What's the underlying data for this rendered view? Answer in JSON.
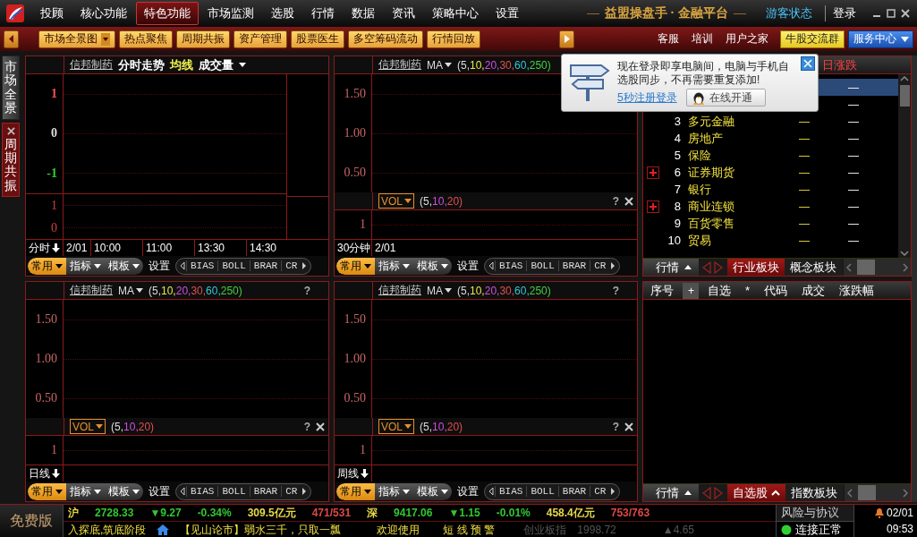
{
  "menu": {
    "items": [
      {
        "label": "投顾",
        "selected": false
      },
      {
        "label": "核心功能",
        "selected": false
      },
      {
        "label": "特色功能",
        "selected": true
      },
      {
        "label": "市场监测",
        "selected": false
      },
      {
        "label": "选股",
        "selected": false
      },
      {
        "label": "行情",
        "selected": false
      },
      {
        "label": "数据",
        "selected": false
      },
      {
        "label": "资讯",
        "selected": false
      },
      {
        "label": "策略中心",
        "selected": false
      },
      {
        "label": "设置",
        "selected": false
      }
    ],
    "title": "益盟操盘手 · 金融平台",
    "guest": "游客状态",
    "login": "登录"
  },
  "toolbar": {
    "buttons": [
      {
        "label": "市场全景图",
        "dropdown": true
      },
      {
        "label": "热点聚焦",
        "dropdown": false
      },
      {
        "label": "周期共振",
        "dropdown": false
      },
      {
        "label": "资产管理",
        "dropdown": false
      },
      {
        "label": "股票医生",
        "dropdown": false
      },
      {
        "label": "多空筹码流动",
        "dropdown": false
      },
      {
        "label": "行情回放",
        "dropdown": false
      }
    ],
    "links": [
      "客服",
      "培训",
      "用户之家"
    ],
    "group_button": "牛股交流群",
    "service_button": "服务中心"
  },
  "side_tabs": [
    {
      "label": "市场全景",
      "selected": false,
      "closable": false
    },
    {
      "label": "周期共振",
      "selected": true,
      "closable": true
    }
  ],
  "charts": [
    {
      "kind": "intraday",
      "stock": "信邦制药",
      "header_items": [
        {
          "text": "分时走势",
          "color": "#ffffff"
        },
        {
          "text": "均线",
          "color": "#f0f050"
        },
        {
          "text": "成交量",
          "color": "#ffffff"
        }
      ],
      "y_labels": [
        {
          "text": "1",
          "color": "#ff5050"
        },
        {
          "text": "0",
          "color": "#dddddd"
        },
        {
          "text": "-1",
          "color": "#30d030"
        }
      ],
      "sub_y_labels": [
        "1",
        "0"
      ],
      "period": "分时",
      "time_labels": [
        "2/01",
        "10:00",
        "11:00",
        "13:30",
        "14:30"
      ],
      "tools": {
        "tabs": [
          {
            "label": "常用",
            "selected": true
          },
          {
            "label": "指标",
            "selected": false
          },
          {
            "label": "模板",
            "selected": false
          }
        ],
        "settings": "设置",
        "indicators": [
          "BIAS",
          "BOLL",
          "BRAR",
          "CR"
        ]
      }
    },
    {
      "kind": "kline",
      "stock": "信邦制药",
      "indicator": "MA",
      "params": [
        {
          "text": "(5,",
          "color": "#dddddd"
        },
        {
          "text": "10,",
          "color": "#e8e84a"
        },
        {
          "text": "20,",
          "color": "#d050e0"
        },
        {
          "text": "30,",
          "color": "#e05050"
        },
        {
          "text": "60,",
          "color": "#30c8d8"
        },
        {
          "text": "250)",
          "color": "#40d040"
        }
      ],
      "y_labels": [
        "1.50",
        "1.00",
        "0.50"
      ],
      "vol_indicator": "VOL",
      "vol_params": [
        {
          "text": "(5,",
          "color": "#dddddd"
        },
        {
          "text": "10,",
          "color": "#d050e0"
        },
        {
          "text": "20)",
          "color": "#e05050"
        }
      ],
      "vol_help": "?",
      "vol_closable": true,
      "vol_y_labels": [
        "1"
      ],
      "period": "30分钟",
      "time_labels": [
        "2/01"
      ],
      "tools": {
        "tabs": [
          {
            "label": "常用",
            "selected": true
          },
          {
            "label": "指标",
            "selected": false
          },
          {
            "label": "模板",
            "selected": false
          }
        ],
        "settings": "设置",
        "indicators": [
          "BIAS",
          "BOLL",
          "BRAR",
          "CR"
        ]
      }
    },
    {
      "kind": "kline",
      "stock": "信邦制药",
      "indicator": "MA",
      "params": [
        {
          "text": "(5,",
          "color": "#dddddd"
        },
        {
          "text": "10,",
          "color": "#e8e84a"
        },
        {
          "text": "20,",
          "color": "#d050e0"
        },
        {
          "text": "30,",
          "color": "#e05050"
        },
        {
          "text": "60,",
          "color": "#30c8d8"
        },
        {
          "text": "250)",
          "color": "#40d040"
        }
      ],
      "help": "?",
      "y_labels": [
        "1.50",
        "1.00",
        "0.50"
      ],
      "vol_indicator": "VOL",
      "vol_params": [
        {
          "text": "(5,",
          "color": "#dddddd"
        },
        {
          "text": "10,",
          "color": "#d050e0"
        },
        {
          "text": "20)",
          "color": "#e05050"
        }
      ],
      "vol_help": "?",
      "vol_closable": true,
      "vol_y_labels": [
        "1"
      ],
      "period": "日线",
      "tools": {
        "tabs": [
          {
            "label": "常用",
            "selected": true
          },
          {
            "label": "指标",
            "selected": false
          },
          {
            "label": "模板",
            "selected": false
          }
        ],
        "settings": "设置",
        "indicators": [
          "BIAS",
          "BOLL",
          "BRAR",
          "CR"
        ]
      }
    },
    {
      "kind": "kline",
      "stock": "信邦制药",
      "indicator": "MA",
      "params": [
        {
          "text": "(5,",
          "color": "#dddddd"
        },
        {
          "text": "10,",
          "color": "#e8e84a"
        },
        {
          "text": "20,",
          "color": "#d050e0"
        },
        {
          "text": "30,",
          "color": "#e05050"
        },
        {
          "text": "60,",
          "color": "#30c8d8"
        },
        {
          "text": "250)",
          "color": "#40d040"
        }
      ],
      "help": "?",
      "y_labels": [
        "1.50",
        "1.00",
        "0.50"
      ],
      "vol_indicator": "VOL",
      "vol_params": [
        {
          "text": "(5,",
          "color": "#dddddd"
        },
        {
          "text": "10,",
          "color": "#d050e0"
        },
        {
          "text": "20)",
          "color": "#e05050"
        }
      ],
      "vol_help": "?",
      "vol_closable": true,
      "vol_y_labels": [
        "1"
      ],
      "period": "周线",
      "tools": {
        "tabs": [
          {
            "label": "常用",
            "selected": true
          },
          {
            "label": "指标",
            "selected": false
          },
          {
            "label": "模板",
            "selected": false
          }
        ],
        "settings": "设置",
        "indicators": [
          "BIAS",
          "BOLL",
          "BRAR",
          "CR"
        ]
      }
    }
  ],
  "top_list": {
    "header": {
      "col_4": "日涨跌"
    },
    "rows": [
      {
        "col_4": "—",
        "selected": true
      },
      {
        "col_4": "—",
        "selected": false
      },
      {
        "index": "3",
        "name": "多元金融",
        "col_3": "—",
        "col_4": "—",
        "selected": false,
        "expand_marker": false
      },
      {
        "index": "4",
        "name": "房地产",
        "col_3": "—",
        "col_4": "—",
        "selected": false,
        "expand_marker": false
      },
      {
        "index": "5",
        "name": "保险",
        "col_3": "—",
        "col_4": "—",
        "selected": false,
        "expand_marker": false
      },
      {
        "index": "6",
        "name": "证券期货",
        "col_3": "—",
        "col_4": "—",
        "selected": false,
        "expand_marker": true
      },
      {
        "index": "7",
        "name": "银行",
        "col_3": "—",
        "col_4": "—",
        "selected": false,
        "expand_marker": false
      },
      {
        "index": "8",
        "name": "商业连锁",
        "col_3": "—",
        "col_4": "—",
        "selected": false,
        "expand_marker": true
      },
      {
        "index": "9",
        "name": "百货零售",
        "col_3": "—",
        "col_4": "—",
        "selected": false,
        "expand_marker": false
      },
      {
        "index": "10",
        "name": "贸易",
        "col_3": "—",
        "col_4": "—",
        "selected": false,
        "expand_marker": false
      }
    ],
    "menu_button": "行情",
    "tabs": [
      {
        "label": "行业板块",
        "selected": true
      },
      {
        "label": "概念板块",
        "selected": false
      }
    ]
  },
  "bottom_list": {
    "columns": [
      {
        "text": "序号",
        "kind": "label"
      },
      {
        "text": "+",
        "kind": "button"
      },
      {
        "text": "自选",
        "kind": "label"
      },
      {
        "text": "*",
        "kind": "label"
      },
      {
        "text": "代码",
        "kind": "label"
      },
      {
        "text": "成交",
        "kind": "label"
      },
      {
        "text": "涨跌幅",
        "kind": "label"
      }
    ],
    "menu_button": "行情",
    "tabs": [
      {
        "label": "自选股",
        "selected": true
      },
      {
        "label": "指数板块",
        "selected": false
      }
    ]
  },
  "popup": {
    "message": "现在登录即享电脑间，电脑与手机自选股同步，不再需要重复添加!",
    "link": "5秒注册登录",
    "button": "在线开通"
  },
  "status": {
    "edition": "免费版",
    "quotes": [
      {
        "text": "沪",
        "color": "#e8d84a"
      },
      {
        "text": "2728.33",
        "color": "#30c830"
      },
      {
        "text": "▼9.27",
        "color": "#30c830"
      },
      {
        "text": "-0.34%",
        "color": "#30c830"
      },
      {
        "text": "309.5亿元",
        "color": "#e8d84a"
      },
      {
        "text": "471/531",
        "color": "#e04848"
      },
      {
        "text": "深",
        "color": "#e8d84a"
      },
      {
        "text": "9417.06",
        "color": "#30c830"
      },
      {
        "text": "▼1.15",
        "color": "#30c830"
      },
      {
        "text": "-0.01%",
        "color": "#30c830"
      },
      {
        "text": "458.4亿元",
        "color": "#e8d84a"
      },
      {
        "text": "753/763",
        "color": "#e04848"
      }
    ],
    "ticker": "入探底,筑底阶段",
    "news": "【见山论市】弱水三千，只取一瓢",
    "welcome": "欢迎使用",
    "alert": "短 线 预 警",
    "index_name": "创业板指",
    "index_value": "1998.72",
    "index_change": "▲4.65",
    "risk": "风险与协议",
    "connection": "连接正常",
    "date": "02/01",
    "time": "09:53"
  }
}
